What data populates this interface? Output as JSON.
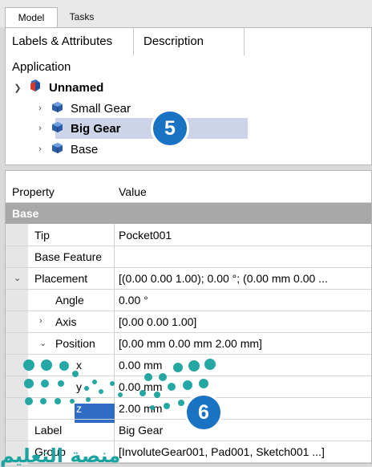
{
  "tabs": {
    "model": "Model",
    "tasks": "Tasks"
  },
  "subtabs": {
    "labels": "Labels & Attributes",
    "description": "Description"
  },
  "tree": {
    "section": "Application",
    "root": "Unnamed",
    "children": [
      "Small Gear",
      "Big Gear",
      "Base"
    ],
    "selected": "Big Gear"
  },
  "badges": {
    "five": "5",
    "six": "6"
  },
  "props": {
    "col_property": "Property",
    "col_value": "Value",
    "group": "Base",
    "rows": [
      {
        "name": "Tip",
        "value": "Pocket001"
      },
      {
        "name": "Base Feature",
        "value": ""
      },
      {
        "name": "Placement",
        "value": "[(0.00 0.00 1.00); 0.00 °; (0.00 mm  0.00 ..."
      },
      {
        "name": "Angle",
        "value": "0.00 °"
      },
      {
        "name": "Axis",
        "value": "[0.00 0.00 1.00]"
      },
      {
        "name": "Position",
        "value": "[0.00 mm  0.00 mm  2.00 mm]"
      },
      {
        "name": "x",
        "value": "0.00 mm"
      },
      {
        "name": "y",
        "value": "0.00 mm"
      },
      {
        "name": "z",
        "value": "2.00 mm"
      },
      {
        "name": "Label",
        "value": "Big Gear"
      },
      {
        "name": "Group",
        "value": "[InvoluteGear001, Pad001, Sketch001 ...]"
      }
    ]
  },
  "watermark": "منصة التعليم",
  "colors": {
    "badge": "#1a73c2",
    "selection": "#cdd3e8",
    "group_header": "#a8a8a8",
    "dots": "#1aa3a0"
  }
}
